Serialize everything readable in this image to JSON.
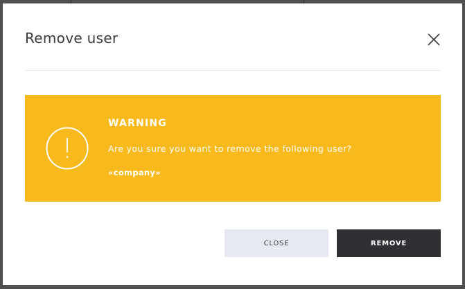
{
  "dialog": {
    "title": "Remove user",
    "close_icon": "close-icon"
  },
  "warning": {
    "icon": "exclamation-circle-icon",
    "heading": "WARNING",
    "message": "Are you sure you want to remove the following user?",
    "user": "«company»"
  },
  "buttons": {
    "close_label": "CLOSE",
    "remove_label": "REMOVE"
  },
  "colors": {
    "warning_background": "#f8b91c",
    "remove_button": "#2f3033",
    "close_button": "#e6e9f2"
  }
}
